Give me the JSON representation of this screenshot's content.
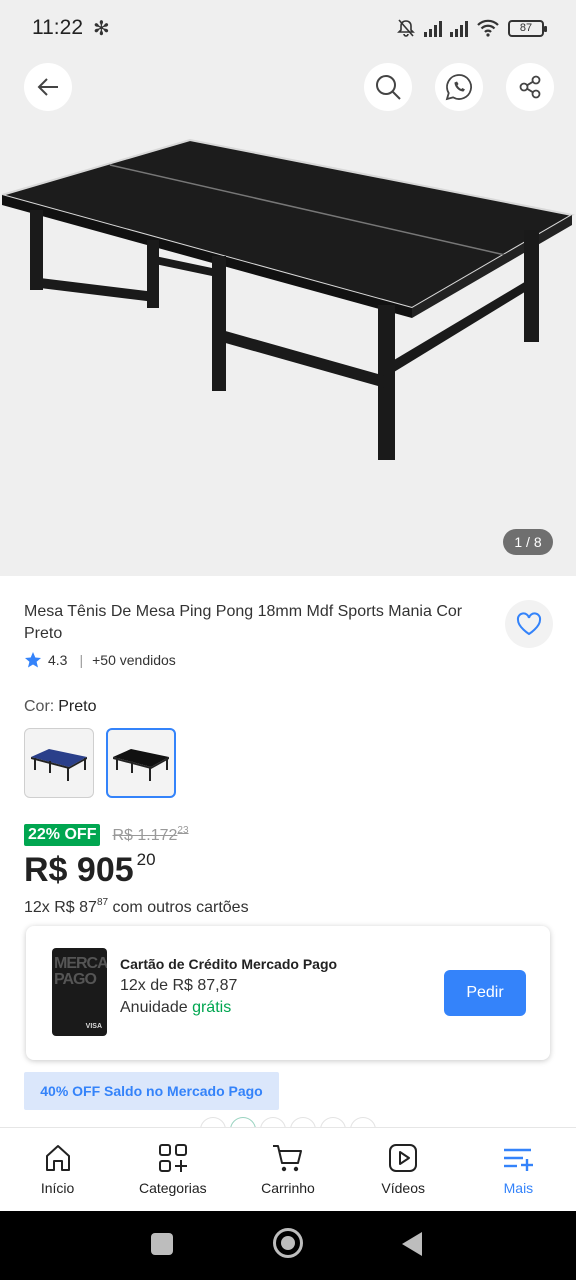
{
  "status_bar": {
    "time": "11:22",
    "battery": "87"
  },
  "gallery": {
    "counter": "1 / 8"
  },
  "product": {
    "title": "Mesa Tênis De Mesa Ping Pong 18mm Mdf Sports Mania Cor Preto",
    "rating": "4.3",
    "sold": "+50 vendidos",
    "color_label": "Cor:",
    "color_value": "Preto",
    "discount_badge": "22% OFF",
    "old_price_main": "R$ 1.172",
    "old_price_cents": "23",
    "price_main": "R$ 905",
    "price_cents": "20",
    "installments_prefix": "12x R$ 87",
    "installments_cents": "87",
    "installments_suffix": "com outros cartões"
  },
  "credit_card": {
    "title": "Cartão de Crédito Mercado Pago",
    "installments": "12x de R$ 87,87",
    "fee_label": "Anuidade",
    "fee_value": "grátis",
    "button": "Pedir",
    "card_brand": "MERCADO PAGO",
    "card_network": "VISA"
  },
  "promo": {
    "saldo": "40% OFF Saldo no Mercado Pago"
  },
  "bottom_nav": {
    "items": [
      {
        "label": "Início"
      },
      {
        "label": "Categorias"
      },
      {
        "label": "Carrinho"
      },
      {
        "label": "Vídeos"
      },
      {
        "label": "Mais"
      }
    ]
  },
  "colors": {
    "accent": "#3483fa",
    "discount": "#00a650"
  }
}
